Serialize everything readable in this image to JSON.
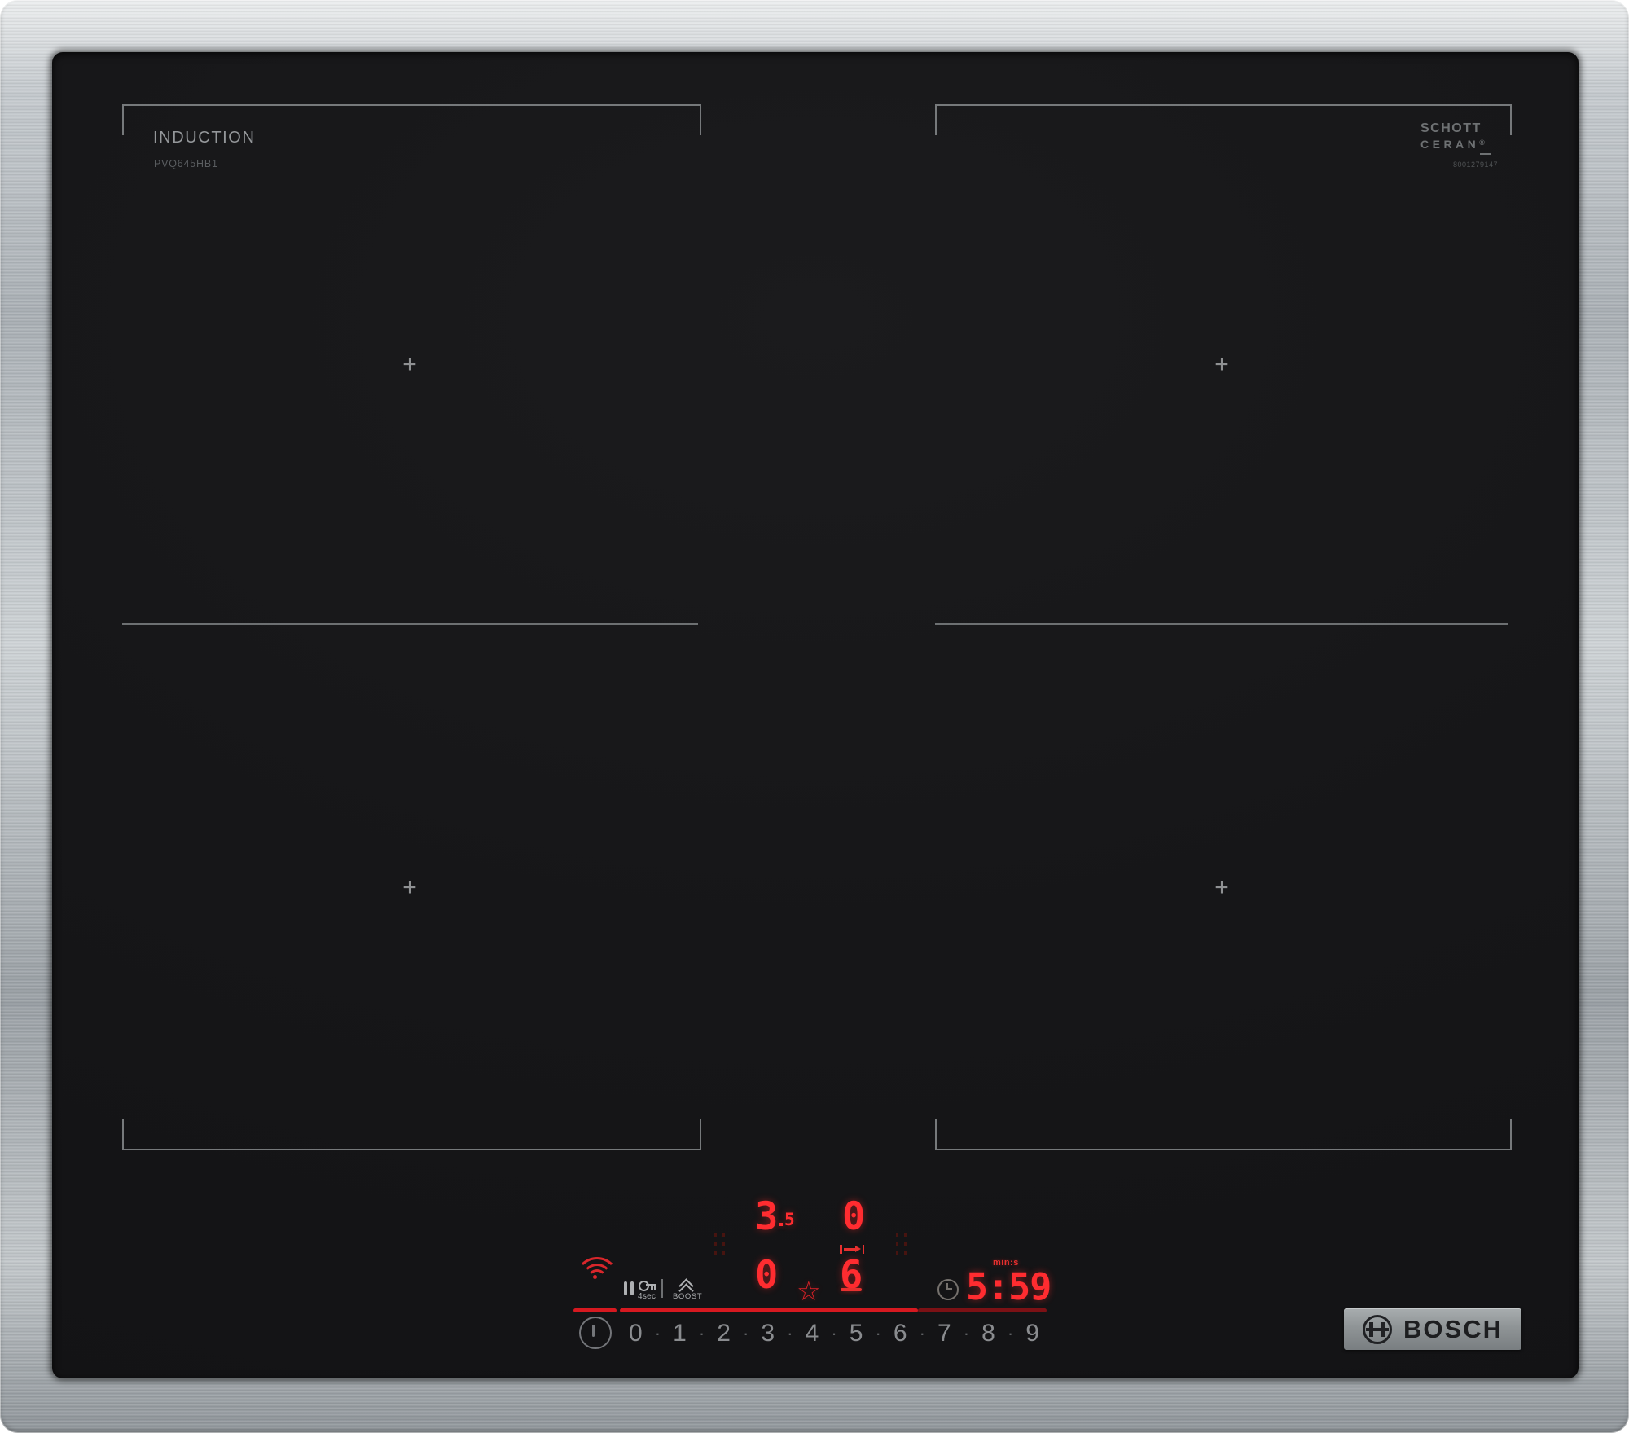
{
  "product": {
    "type_label": "INDUCTION",
    "model": "PVQ645HB1",
    "glass_brand": {
      "line1": "SCHOTT",
      "line2": "CERAN",
      "registered": "®",
      "code": "8001279147"
    },
    "manufacturer": "BOSCH"
  },
  "panel": {
    "zone_levels": {
      "left_rear": {
        "value": "3.5",
        "main": "3",
        "sub": "5"
      },
      "right_rear": {
        "value": "0"
      },
      "left_front": {
        "value": "0"
      },
      "right_front": {
        "value": "6"
      }
    },
    "selected_zone": "right_front",
    "timer": {
      "unit_label": "min:s",
      "value": "5:59"
    },
    "child_lock_label": "4sec",
    "boost_label": "BOOST",
    "power_slider": {
      "levels": [
        "0",
        "1",
        "2",
        "3",
        "4",
        "5",
        "6",
        "7",
        "8",
        "9"
      ],
      "separator": "·",
      "filled_to_level": 6
    }
  },
  "icons": {
    "star": "☆",
    "cross": "+"
  },
  "colors": {
    "accent_red": "#d61920",
    "digit_red": "#ff2c30",
    "dim_red": "#7c1115",
    "steel": "#b6bbbf",
    "glass": "#161618",
    "marking_gray": "#76797b",
    "label_gray": "#94979a",
    "badge_gray": "#8f9496"
  }
}
